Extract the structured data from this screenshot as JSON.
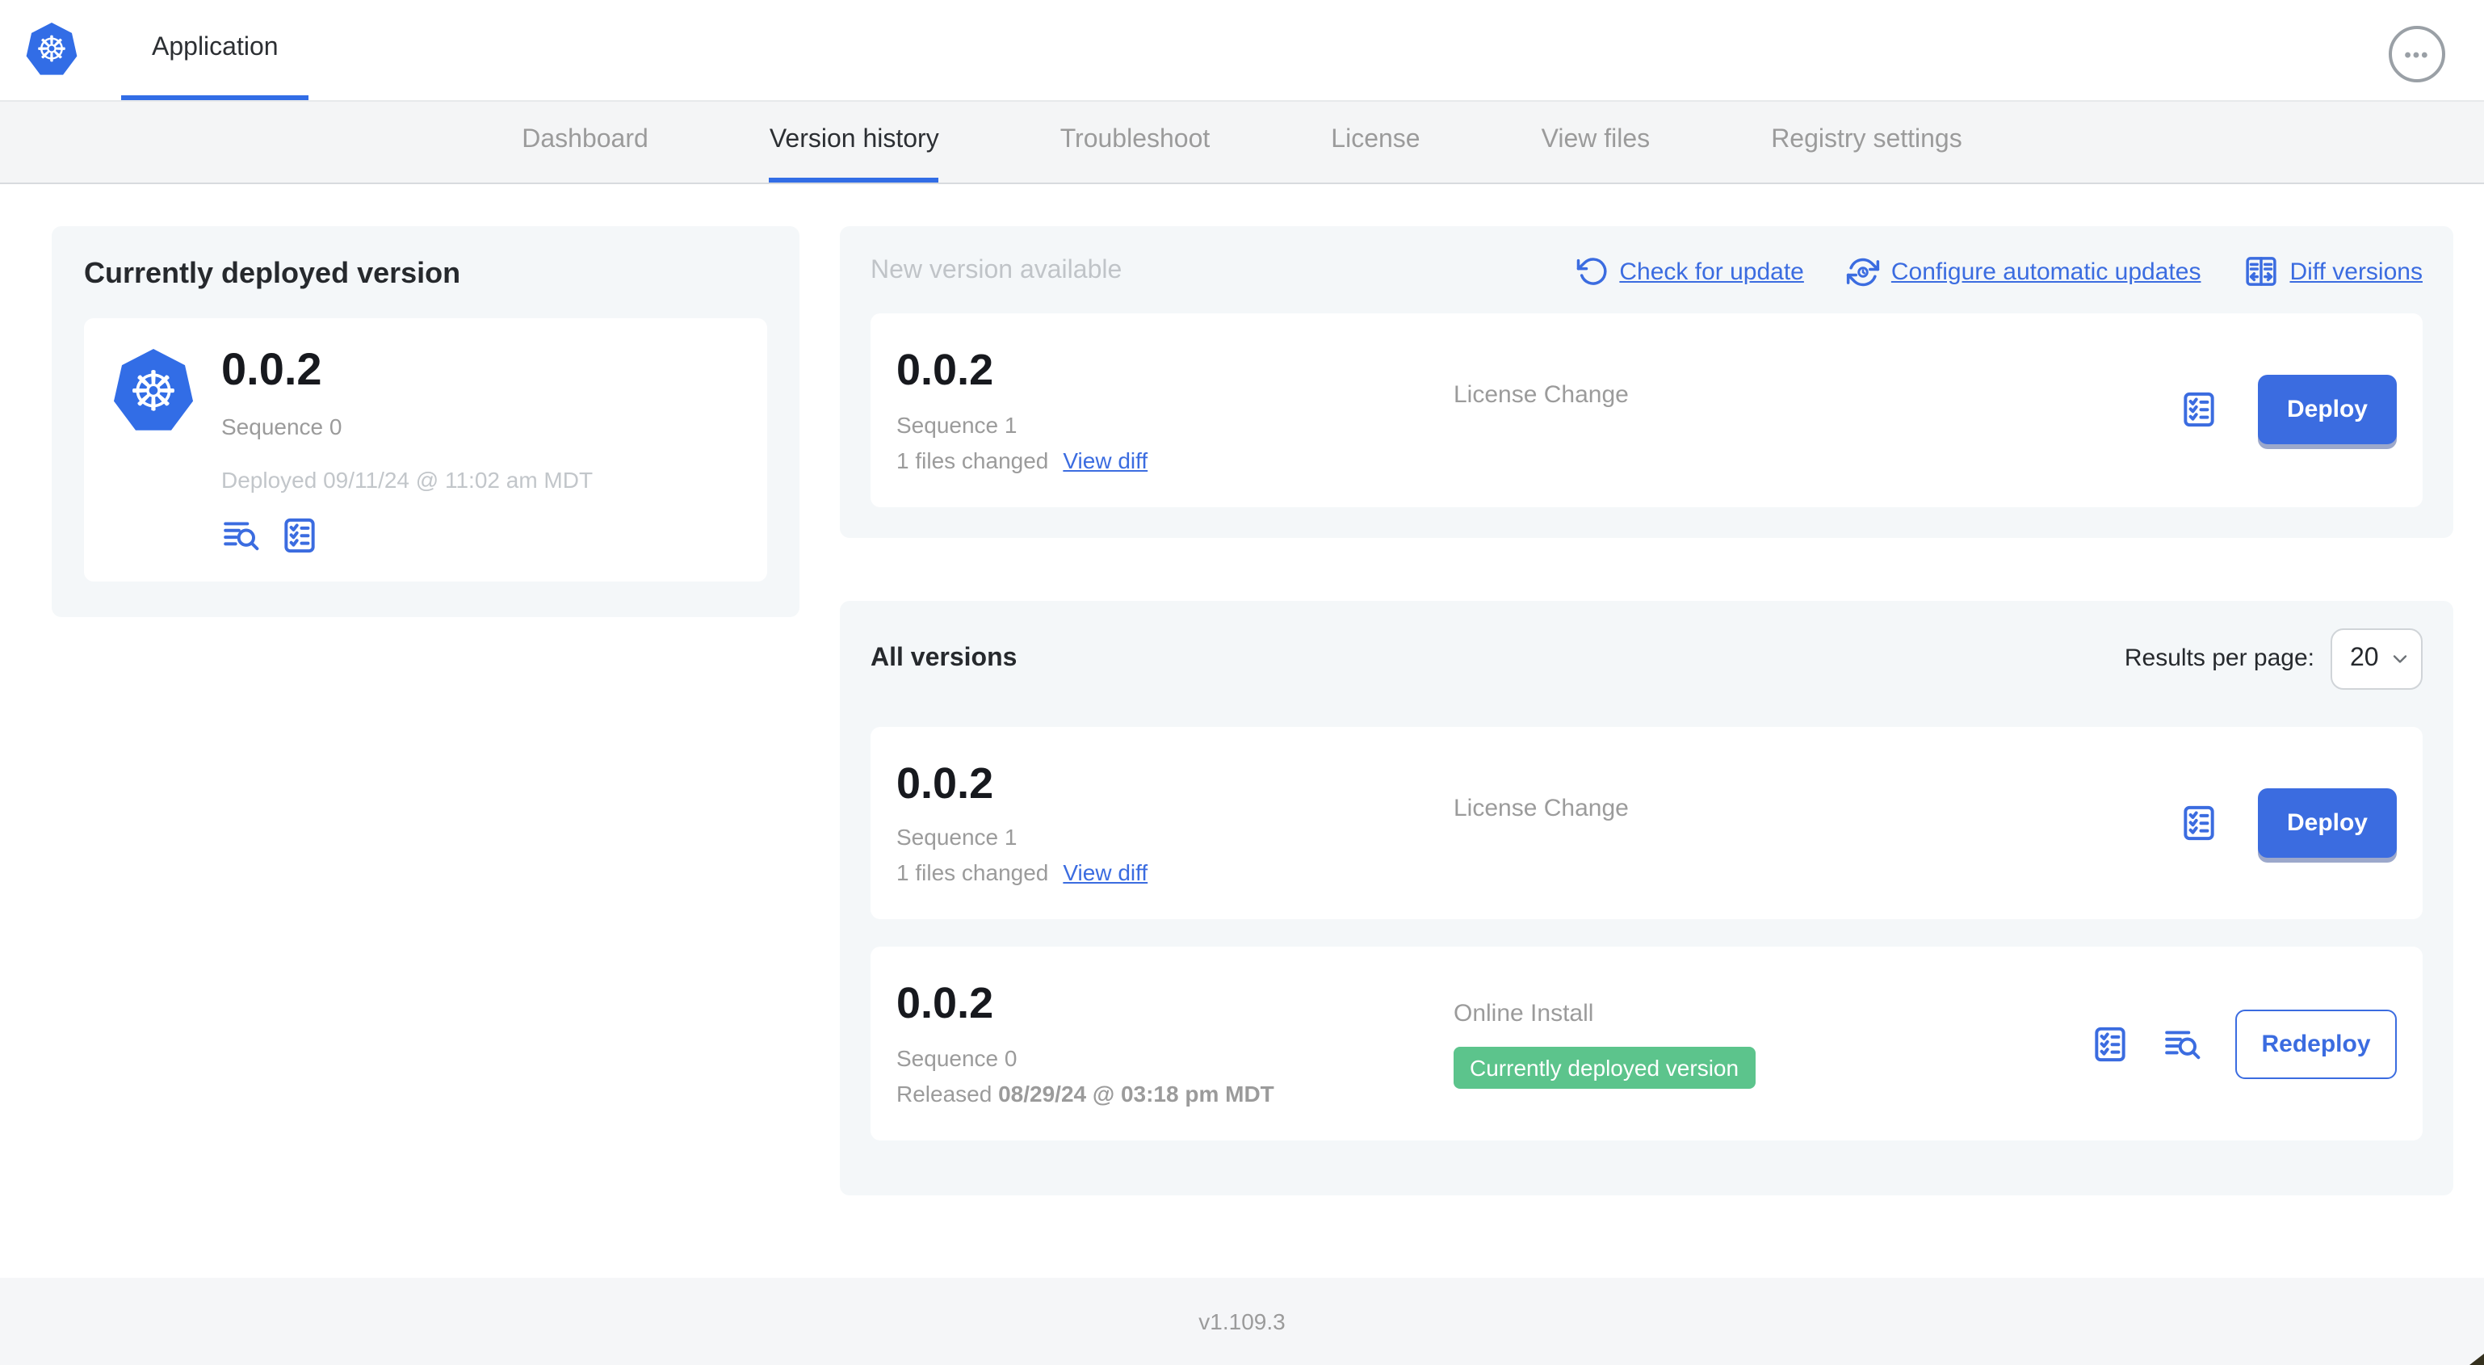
{
  "header": {
    "app_name": "Application"
  },
  "nav": {
    "tabs": [
      {
        "label": "Dashboard",
        "active": false
      },
      {
        "label": "Version history",
        "active": true
      },
      {
        "label": "Troubleshoot",
        "active": false
      },
      {
        "label": "License",
        "active": false
      },
      {
        "label": "View files",
        "active": false
      },
      {
        "label": "Registry settings",
        "active": false
      }
    ]
  },
  "deployed_card": {
    "title": "Currently deployed version",
    "version": "0.0.2",
    "sequence": "Sequence 0",
    "deployed": "Deployed 09/11/24 @ 11:02 am MDT"
  },
  "new_version_section": {
    "title": "New version available",
    "actions": [
      {
        "label": "Check for update",
        "icon": "rotate-ccw-icon"
      },
      {
        "label": "Configure automatic updates",
        "icon": "auto-update-clock-icon"
      },
      {
        "label": "Diff versions",
        "icon": "diff-columns-icon"
      }
    ],
    "card": {
      "version": "0.0.2",
      "sequence": "Sequence 1",
      "files_changed": "1 files changed",
      "view_diff_label": "View diff",
      "source": "License Change",
      "deploy_label": "Deploy"
    }
  },
  "all_versions_section": {
    "title": "All versions",
    "results_per_page_label": "Results per page:",
    "results_per_page": "20",
    "rows": [
      {
        "version": "0.0.2",
        "sequence": "Sequence 1",
        "files_changed": "1 files changed",
        "view_diff_label": "View diff",
        "source": "License Change",
        "action_label": "Deploy"
      },
      {
        "version": "0.0.2",
        "sequence": "Sequence 0",
        "released_prefix": "Released ",
        "released_date": "08/29/24 @ 03:18 pm MDT",
        "source": "Online Install",
        "badge": "Currently deployed version",
        "action_label": "Redeploy"
      }
    ]
  },
  "footer": {
    "app_version": "v1.109.3"
  },
  "icons": {
    "app_logo": "kubernetes-logo",
    "top_right_menu": "ellipsis-icon",
    "check_for_update": "rotate-ccw-icon",
    "configure_automatic_updates": "auto-update-clock-icon",
    "diff_versions": "diff-columns-icon",
    "preflight_checks": "checklist-icon",
    "deploy_logs": "logs-magnifier-icon",
    "select_caret": "chevron-down-icon",
    "app_logo_glyph": "☸",
    "ellipsis_glyph": "•••"
  },
  "colors": {
    "accent": "#3b6ce0",
    "k8s_blue": "#326de6",
    "badge_green": "#5cc48c",
    "text_dark": "#323232",
    "text_gray": "#9b9b9b",
    "panel_bg": "#f4f7f9"
  }
}
